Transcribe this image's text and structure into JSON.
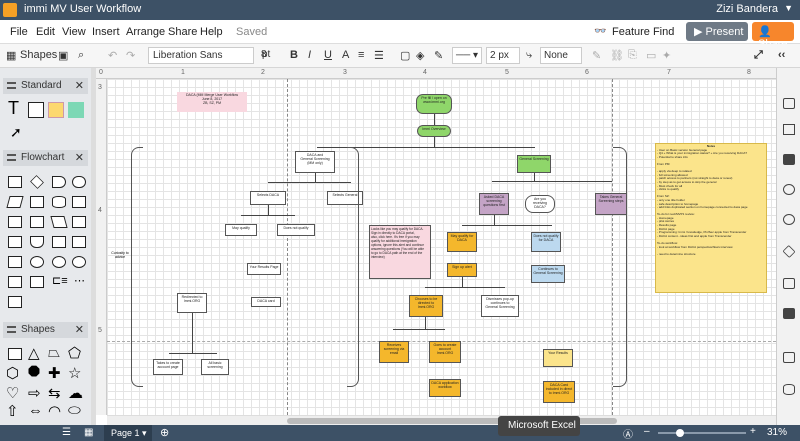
{
  "titlebar": {
    "title": "immi MV User Workflow",
    "user": "Zizi Bandera"
  },
  "menu": {
    "items": [
      "File",
      "Edit",
      "View",
      "Insert",
      "Arrange",
      "Share",
      "Help"
    ],
    "saved": "Saved",
    "feature_find": "Feature Find",
    "present": "Present",
    "share": "Share"
  },
  "toolbar": {
    "shapes": "Shapes",
    "font": "Liberation Sans",
    "font_size": "8",
    "font_unit": "pt",
    "bold": "B",
    "italic": "I",
    "underline": "U",
    "line_width": "2 px",
    "arrow": "None"
  },
  "left": {
    "standard": "Standard",
    "flowchart": "Flowchart",
    "shapes": "Shapes",
    "text_tool": "T"
  },
  "ruler": {
    "top": [
      "0",
      "1",
      "2",
      "3",
      "4",
      "5",
      "6",
      "7",
      "8"
    ],
    "left": [
      "3",
      "4",
      "5"
    ]
  },
  "diagram": {
    "title": "DACA (MM Merge User Workflow\nJune 8, 2017\nZB, SZ, PM",
    "start": "Pre fill / open on\nwww.immi.org",
    "intro": "Immi Overview",
    "left_root": "DACA and\nGeneral Screening\n(MM only)",
    "selects_daca": "Selects DACA",
    "selects_general": "Selects General",
    "may_qualify": "May qualify",
    "does_not_qualify": "Does not qualify",
    "your_results": "Your Results Page",
    "daca_card": "DACA card",
    "redirected": "Redirected to\nImmi.ORG",
    "takes_create": "Takes to create\naccount page",
    "all_basic": "All basic\nscreening",
    "curiosity": "Curiosity\nto\nadvice",
    "general_screening": "General Screening",
    "asked_daca": "Asked DACA\nscreening\nquestions first",
    "are_you_daca": "Are you\nreceiving DACA?",
    "takes_general": "Takes General\nScreening steps",
    "may_qualify_daca": "May qualify for\nDACA",
    "does_not_qualify_daca": "Does not qualify\nfor DACA",
    "sign_up": "Sign up alert",
    "continues_general": "Continues to\nGeneral Screening",
    "chooses_to_be": "Chooses to be\ndirected to\nImmi.ORG",
    "dismisses_popup": "Dismisses pop-up\ncontinues to\nGeneral Screening",
    "receives_email": "Receives\nscreening via\nemail",
    "goes_to_create": "Goes to create\naccount\nImmi.ORG",
    "daca_application": "DACA application\nworkflow",
    "your_results_r": "Your Results",
    "daca_card_r": "DACA Card\nincluded in direct\nto Immi.ORG",
    "pink_note": "Looks like you may qualify for DACA.\nSign in directly to DACA portal,\nalso, click here. It's free if you may\nqualify for additional immigration\noptions, ignore this alert and continue\nanswering questions (You will be able\nto go to DACA path at the end of the\ninterview)",
    "notes_title": "Notes",
    "notes_body": "- User on Basic version General page\n- Q4 + What is your immigration status? + Are you receiving DACA?\n- Potential to share info\n\nFrom PM:\n\n- apply via deep to related\n- full screening allowed\n- patch access to partners (not straight to daca or renew)\n- by step as to get access to skip the general\n- Must check for all\n- clicks to qualify\n\nFrom SZ:\n- only one title holder\n- safe description to homepage\n- add links duplicated section on homepage connected to daca page\n\nTo-do for next/MVP1 review:\n- Homepage\n- pilot stories\n- Results page\n- DACA page\n- Programming: Immi / knowledge, Pin/Sec apple from Transcender\n- DACA content - ideas first and apple from Transcender\n\nTo-do workflow:\n- look at workflow from DACA perspective/flows interview\n\n- need to determine structure"
  },
  "bottom": {
    "page": "Page 1",
    "zoom": "31%",
    "tooltip": "Microsoft Excel"
  }
}
